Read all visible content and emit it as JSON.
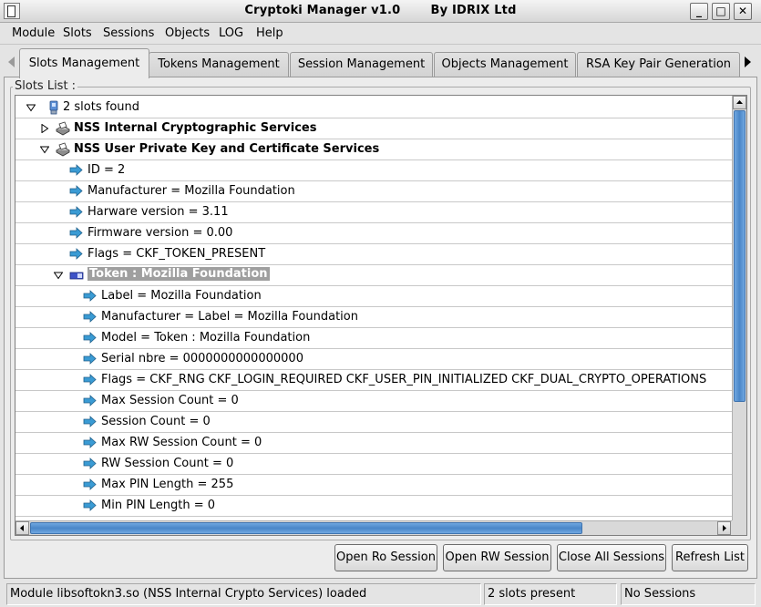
{
  "window": {
    "title": "Cryptoki Manager v1.0       By IDRIX Ltd",
    "controls": [
      "_",
      "□",
      "✕"
    ]
  },
  "menu": [
    "Module",
    "Slots",
    "Sessions",
    "Objects",
    "LOG",
    "Help"
  ],
  "tabs": [
    {
      "label": "Slots Management",
      "active": true
    },
    {
      "label": "Tokens Management",
      "active": false
    },
    {
      "label": "Session Management",
      "active": false
    },
    {
      "label": "Objects Management",
      "active": false
    },
    {
      "label": "RSA Key Pair Generation",
      "active": false
    }
  ],
  "slots_list": {
    "label": "Slots List :",
    "rows": [
      {
        "text": "2 slots found",
        "icon": "computer-icon",
        "expander": "expanded"
      },
      {
        "text": "NSS Internal Cryptographic Services",
        "icon": "card-reader-icon",
        "expander": "collapsed",
        "bold": true
      },
      {
        "text": "NSS User Private Key and Certificate Services",
        "icon": "card-reader-icon",
        "expander": "expanded",
        "bold": true
      },
      {
        "text": "ID = 2",
        "icon": "arrow-right-icon"
      },
      {
        "text": "Manufacturer = Mozilla Foundation",
        "icon": "arrow-right-icon"
      },
      {
        "text": "Harware version = 3.11",
        "icon": "arrow-right-icon"
      },
      {
        "text": "Firmware version = 0.00",
        "icon": "arrow-right-icon"
      },
      {
        "text": "Flags = CKF_TOKEN_PRESENT",
        "icon": "arrow-right-icon"
      },
      {
        "text": "Token : Mozilla Foundation",
        "icon": "token-icon",
        "expander": "expanded",
        "selected": true
      },
      {
        "text": "Label = Mozilla Foundation",
        "icon": "arrow-right-icon"
      },
      {
        "text": "Manufacturer = Label = Mozilla Foundation",
        "icon": "arrow-right-icon"
      },
      {
        "text": "Model = Token : Mozilla Foundation",
        "icon": "arrow-right-icon"
      },
      {
        "text": "Serial nbre = 0000000000000000",
        "icon": "arrow-right-icon"
      },
      {
        "text": "Flags = CKF_RNG CKF_LOGIN_REQUIRED CKF_USER_PIN_INITIALIZED CKF_DUAL_CRYPTO_OPERATIONS",
        "icon": "arrow-right-icon"
      },
      {
        "text": "Max Session Count = 0",
        "icon": "arrow-right-icon"
      },
      {
        "text": "Session Count = 0",
        "icon": "arrow-right-icon"
      },
      {
        "text": "Max RW Session Count = 0",
        "icon": "arrow-right-icon"
      },
      {
        "text": "RW Session Count = 0",
        "icon": "arrow-right-icon"
      },
      {
        "text": "Max PIN Length = 255",
        "icon": "arrow-right-icon"
      },
      {
        "text": "Min PIN Length = 0",
        "icon": "arrow-right-icon"
      }
    ]
  },
  "buttons": {
    "open_ro": "Open Ro Session",
    "open_rw": "Open RW Session",
    "close_all": "Close All Sessions",
    "refresh": "Refresh List"
  },
  "status": {
    "message": "Module libsoftokn3.so (NSS Internal Crypto Services) loaded",
    "slots": "2 slots present",
    "sessions": "No Sessions"
  },
  "colors": {
    "selection": "#9f9f9f",
    "scroll_thumb": "#4a86c8",
    "arrow_icon": "#3a9bd4"
  }
}
